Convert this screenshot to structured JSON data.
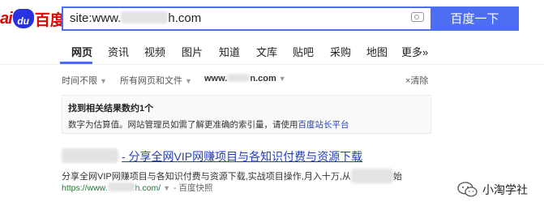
{
  "logo": {
    "part1": "ai",
    "paw": "du",
    "part2": "百度"
  },
  "search": {
    "prefix": "site:www.",
    "suffix": "h.com",
    "button_label": "百度一下"
  },
  "tabs": [
    {
      "label": "网页",
      "active": true
    },
    {
      "label": "资讯"
    },
    {
      "label": "视频"
    },
    {
      "label": "图片"
    },
    {
      "label": "知道"
    },
    {
      "label": "文库"
    },
    {
      "label": "贴吧"
    },
    {
      "label": "采购"
    },
    {
      "label": "地图"
    },
    {
      "label": "更多»"
    }
  ],
  "filters": {
    "time": "时间不限",
    "scope": "所有网页和文件",
    "site_prefix": "www.",
    "site_suffix": "n.com",
    "clear": "×清除"
  },
  "notice": {
    "title": "找到相关结果数约1个",
    "body": "数字为估算值。网站管理员如需了解更准确的索引量，请使用",
    "link": "百度站长平台"
  },
  "result": {
    "title": "- 分享全网VIP网赚项目与各知识付费与资源下载",
    "snippet_start": "分享全网VIP网赚项目与各知识付费与资源下载,实战项目操作,月入十万,从",
    "snippet_end": "始",
    "url_prefix": "https://www.",
    "url_suffix": "h.com/",
    "url_separator": "-",
    "snapshot": "百度快照"
  },
  "watermark": {
    "text": "小淘学社",
    "icon": "wechat-icon"
  },
  "colors": {
    "accent": "#4e6ef2",
    "link": "#2440b3",
    "url_green": "#1f7a36",
    "logo_red": "#e10602",
    "logo_blue": "#2932e1"
  }
}
